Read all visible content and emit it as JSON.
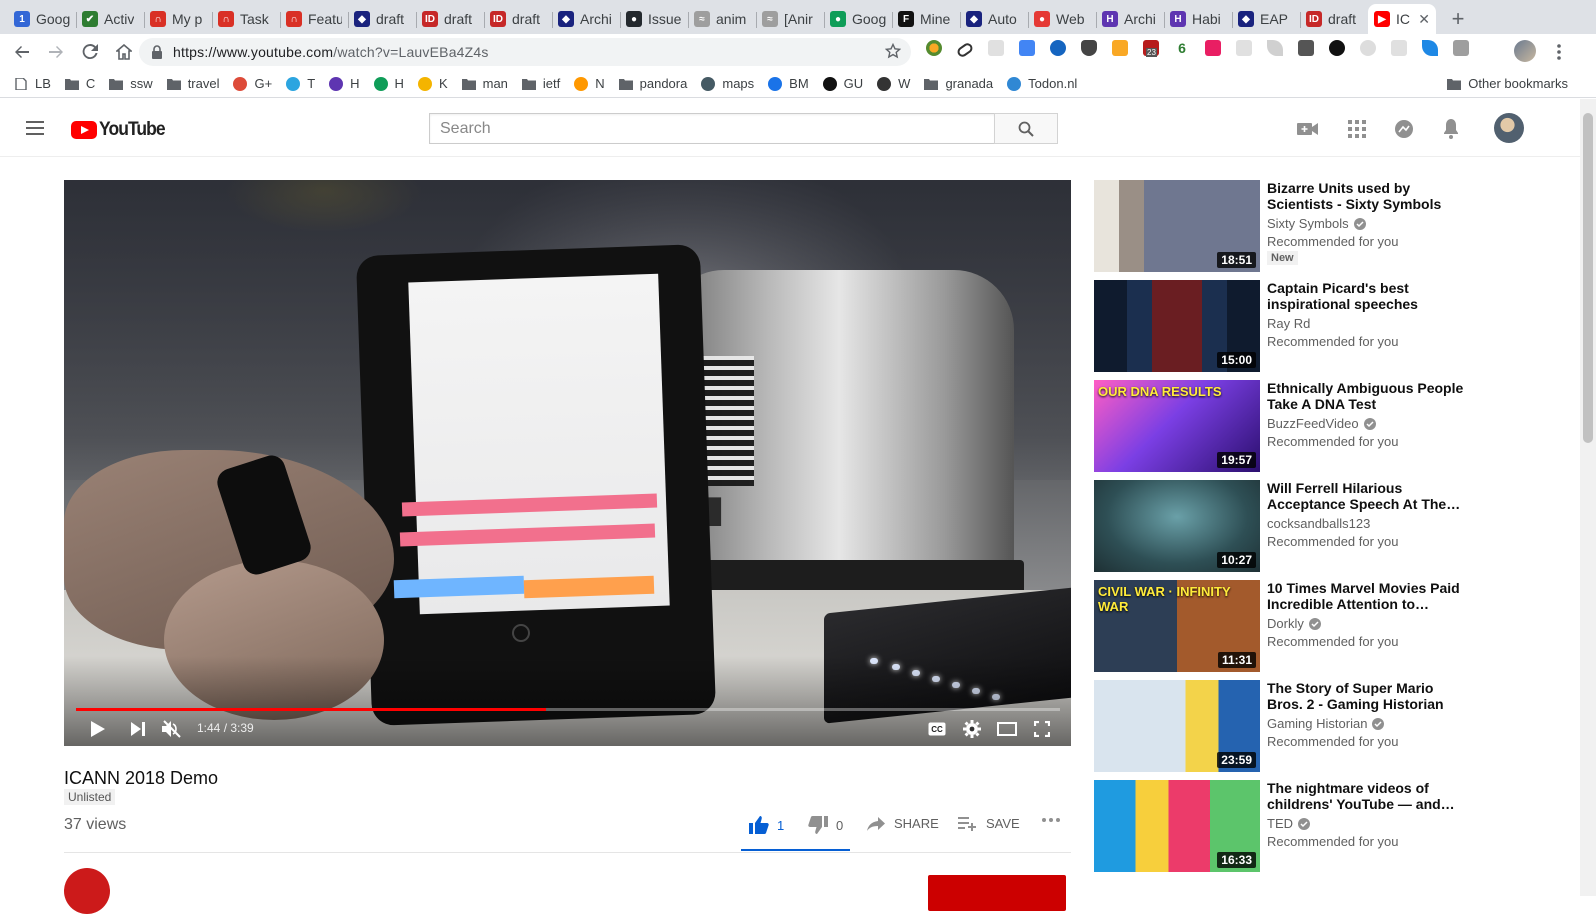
{
  "browser": {
    "tabs": [
      {
        "label": "Goog",
        "color": "#3367d6",
        "glyph": "1"
      },
      {
        "label": "Activ",
        "color": "#2e7d32",
        "glyph": "✔"
      },
      {
        "label": "My p",
        "color": "#d93025",
        "glyph": "∩"
      },
      {
        "label": "Task",
        "color": "#d93025",
        "glyph": "∩"
      },
      {
        "label": "Featu",
        "color": "#d93025",
        "glyph": "∩"
      },
      {
        "label": "draft",
        "color": "#1a237e",
        "glyph": "◆"
      },
      {
        "label": "draft",
        "color": "#c62828",
        "glyph": "ID"
      },
      {
        "label": "draft",
        "color": "#c62828",
        "glyph": "ID"
      },
      {
        "label": "Archi",
        "color": "#1a237e",
        "glyph": "◆"
      },
      {
        "label": "Issue",
        "color": "#24292e",
        "glyph": "●"
      },
      {
        "label": "anim",
        "color": "#9e9e9e",
        "glyph": "≈"
      },
      {
        "label": "[Anir",
        "color": "#9e9e9e",
        "glyph": "≈"
      },
      {
        "label": "Goog",
        "color": "#0f9d58",
        "glyph": "●"
      },
      {
        "label": "Mine",
        "color": "#111111",
        "glyph": "F"
      },
      {
        "label": "Auto",
        "color": "#1a237e",
        "glyph": "◆"
      },
      {
        "label": "Web",
        "color": "#e53935",
        "glyph": "●"
      },
      {
        "label": "Archi",
        "color": "#5e35b1",
        "glyph": "H"
      },
      {
        "label": "Habi",
        "color": "#5e35b1",
        "glyph": "H"
      },
      {
        "label": "EAP",
        "color": "#1a237e",
        "glyph": "◆"
      },
      {
        "label": "draft",
        "color": "#c62828",
        "glyph": "ID"
      },
      {
        "label": "IC",
        "color": "#ff0000",
        "glyph": "▶"
      }
    ],
    "url_domain": "https://www.youtube.com",
    "url_rest": "/watch?v=LauvEBa4Z4s",
    "extension_badges": {
      "mail_count": "23",
      "score": "6"
    },
    "bookmarks": [
      {
        "label": "LB",
        "kind": "page"
      },
      {
        "label": "C",
        "kind": "folder"
      },
      {
        "label": "ssw",
        "kind": "folder"
      },
      {
        "label": "travel",
        "kind": "folder"
      },
      {
        "label": "G+",
        "kind": "glyph",
        "color": "#dd4b39"
      },
      {
        "label": "T",
        "kind": "glyph",
        "color": "#2ca5e0"
      },
      {
        "label": "H",
        "kind": "glyph",
        "color": "#5e35b1"
      },
      {
        "label": "H",
        "kind": "glyph",
        "color": "#0f9d58"
      },
      {
        "label": "K",
        "kind": "glyph",
        "color": "#f4b400"
      },
      {
        "label": "man",
        "kind": "folder"
      },
      {
        "label": "ietf",
        "kind": "folder"
      },
      {
        "label": "N",
        "kind": "glyph",
        "color": "#ff9800"
      },
      {
        "label": "pandora",
        "kind": "folder"
      },
      {
        "label": "maps",
        "kind": "glyph",
        "color": "#455a64"
      },
      {
        "label": "BM",
        "kind": "glyph",
        "color": "#1a73e8"
      },
      {
        "label": "GU",
        "kind": "glyph",
        "color": "#111111"
      },
      {
        "label": "W",
        "kind": "glyph",
        "color": "#333333"
      },
      {
        "label": "granada",
        "kind": "folder"
      },
      {
        "label": "Todon.nl",
        "kind": "glyph",
        "color": "#3088d4"
      }
    ],
    "other_bookmarks": "Other bookmarks"
  },
  "youtube": {
    "logo_text": "YouTube",
    "search_placeholder": "Search",
    "player": {
      "time_current": "1:44",
      "time_total": "3:39",
      "time_separator": " / ",
      "progress_fraction": 0.478
    },
    "video": {
      "title": "ICANN 2018 Demo",
      "badge": "Unlisted",
      "views": "37 views",
      "likes": "1",
      "dislikes": "0",
      "share_label": "SHARE",
      "save_label": "SAVE"
    },
    "recommendations": [
      {
        "title": "Bizarre Units used by Scientists - Sixty Symbols",
        "channel": "Sixty Symbols",
        "verified": true,
        "meta": "Recommended for you",
        "duration": "18:51",
        "new": "New",
        "thumb": "t1"
      },
      {
        "title": "Captain Picard's best inspirational speeches",
        "channel": "Ray Rd",
        "verified": false,
        "meta": "Recommended for you",
        "duration": "15:00",
        "new": "",
        "thumb": "t2"
      },
      {
        "title": "Ethnically Ambiguous People Take A DNA Test",
        "channel": "BuzzFeedVideo",
        "verified": true,
        "meta": "Recommended for you",
        "duration": "19:57",
        "new": "",
        "thumb": "t3",
        "overlay": "OUR DNA RESULTS"
      },
      {
        "title": "Will Ferrell Hilarious Acceptance Speech At The…",
        "channel": "cocksandballs123",
        "verified": false,
        "meta": "Recommended for you",
        "duration": "10:27",
        "new": "",
        "thumb": "t4"
      },
      {
        "title": "10 Times Marvel Movies Paid Incredible Attention to…",
        "channel": "Dorkly",
        "verified": true,
        "meta": "Recommended for you",
        "duration": "11:31",
        "new": "",
        "thumb": "t5",
        "overlay": "CIVIL WAR · INFINITY WAR"
      },
      {
        "title": "The Story of Super Mario Bros. 2 - Gaming Historian",
        "channel": "Gaming Historian",
        "verified": true,
        "meta": "Recommended for you",
        "duration": "23:59",
        "new": "",
        "thumb": "t6"
      },
      {
        "title": "The nightmare videos of childrens' YouTube — and…",
        "channel": "TED",
        "verified": true,
        "meta": "Recommended for you",
        "duration": "16:33",
        "new": "",
        "thumb": "t7"
      }
    ]
  }
}
